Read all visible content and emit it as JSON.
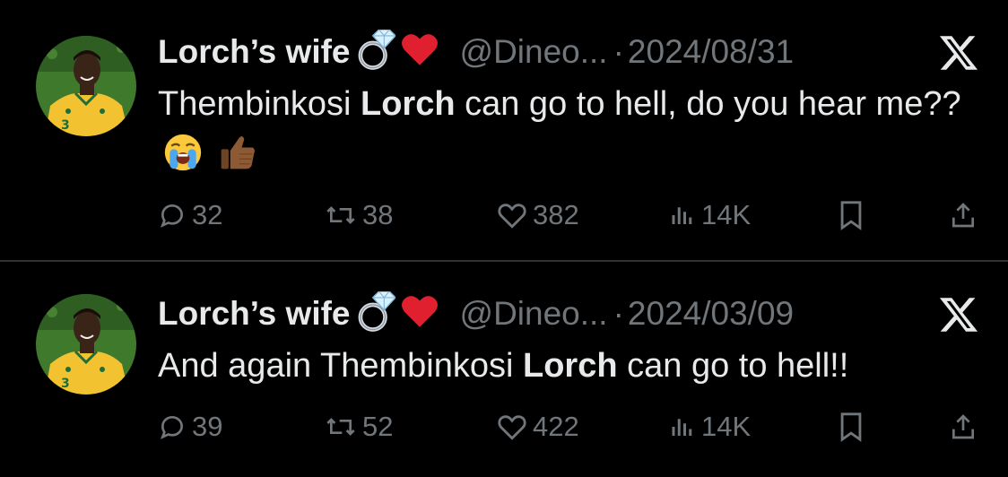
{
  "tweets": [
    {
      "display_name": "Lorch’s wife",
      "name_emojis": [
        "ring-icon",
        "red-heart-icon"
      ],
      "handle": "@Dineo...",
      "separator": "·",
      "date": "2024/08/31",
      "text_parts": [
        "Thembinkosi ",
        "Lorch",
        " can go to hell, do you hear me??"
      ],
      "text_emojis": [
        "loudly-crying-face-icon",
        "thumbs-up-icon"
      ],
      "stats": {
        "replies": "32",
        "retweets": "38",
        "likes": "382",
        "views": "14K"
      }
    },
    {
      "display_name": "Lorch’s wife",
      "name_emojis": [
        "ring-icon",
        "red-heart-icon"
      ],
      "handle": "@Dineo...",
      "separator": "·",
      "date": "2024/03/09",
      "text_parts": [
        "And again Thembinkosi ",
        "Lorch",
        " can go to hell!!"
      ],
      "stats": {
        "replies": "39",
        "retweets": "52",
        "likes": "422",
        "views": "14K"
      }
    }
  ],
  "colors": {
    "background": "#000000",
    "text": "#e7e9ea",
    "muted": "#71767b",
    "divider": "#2f3336",
    "jersey": "#f2c230",
    "pitch": "#3d7a2a"
  }
}
